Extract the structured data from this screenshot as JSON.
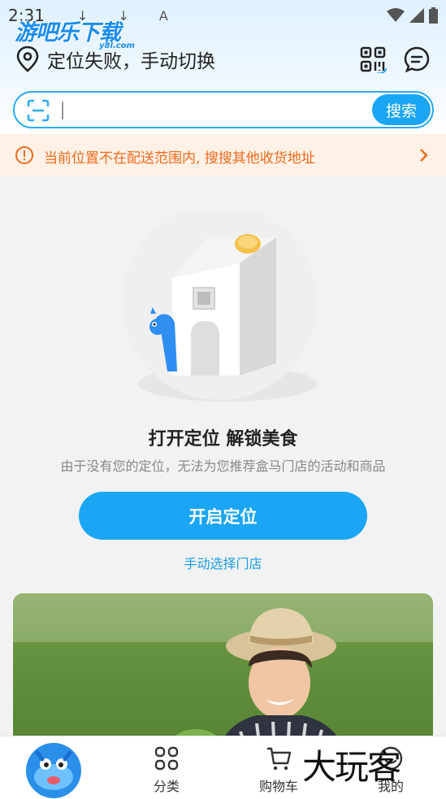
{
  "status_bar": {
    "time": "2:31",
    "mini_icons": "↓ ↓ A"
  },
  "watermark_top": {
    "text": "游吧乐下载",
    "sub": "y8l.com"
  },
  "header": {
    "location_text": "定位失败，手动切换"
  },
  "search": {
    "placeholder": "",
    "button_label": "搜索"
  },
  "notice": {
    "text": "当前位置不在配送范围内, 搜搜其他收货地址"
  },
  "empty_state": {
    "title": "打开定位 解锁美食",
    "description": "由于没有您的定位，无法为您推荐盒马门店的活动和商品",
    "enable_button": "开启定位",
    "manual_link": "手动选择门店"
  },
  "tabbar": {
    "items": [
      {
        "label": "分类",
        "icon": "category-icon"
      },
      {
        "label": "购物车",
        "icon": "cart-icon"
      },
      {
        "label": "我的",
        "icon": "profile-icon"
      }
    ]
  },
  "watermark_bottom": {
    "text": "大玩客"
  },
  "colors": {
    "accent": "#1aa6f5",
    "notice_text": "#f06a1e",
    "notice_bg": "#fff1e5"
  }
}
